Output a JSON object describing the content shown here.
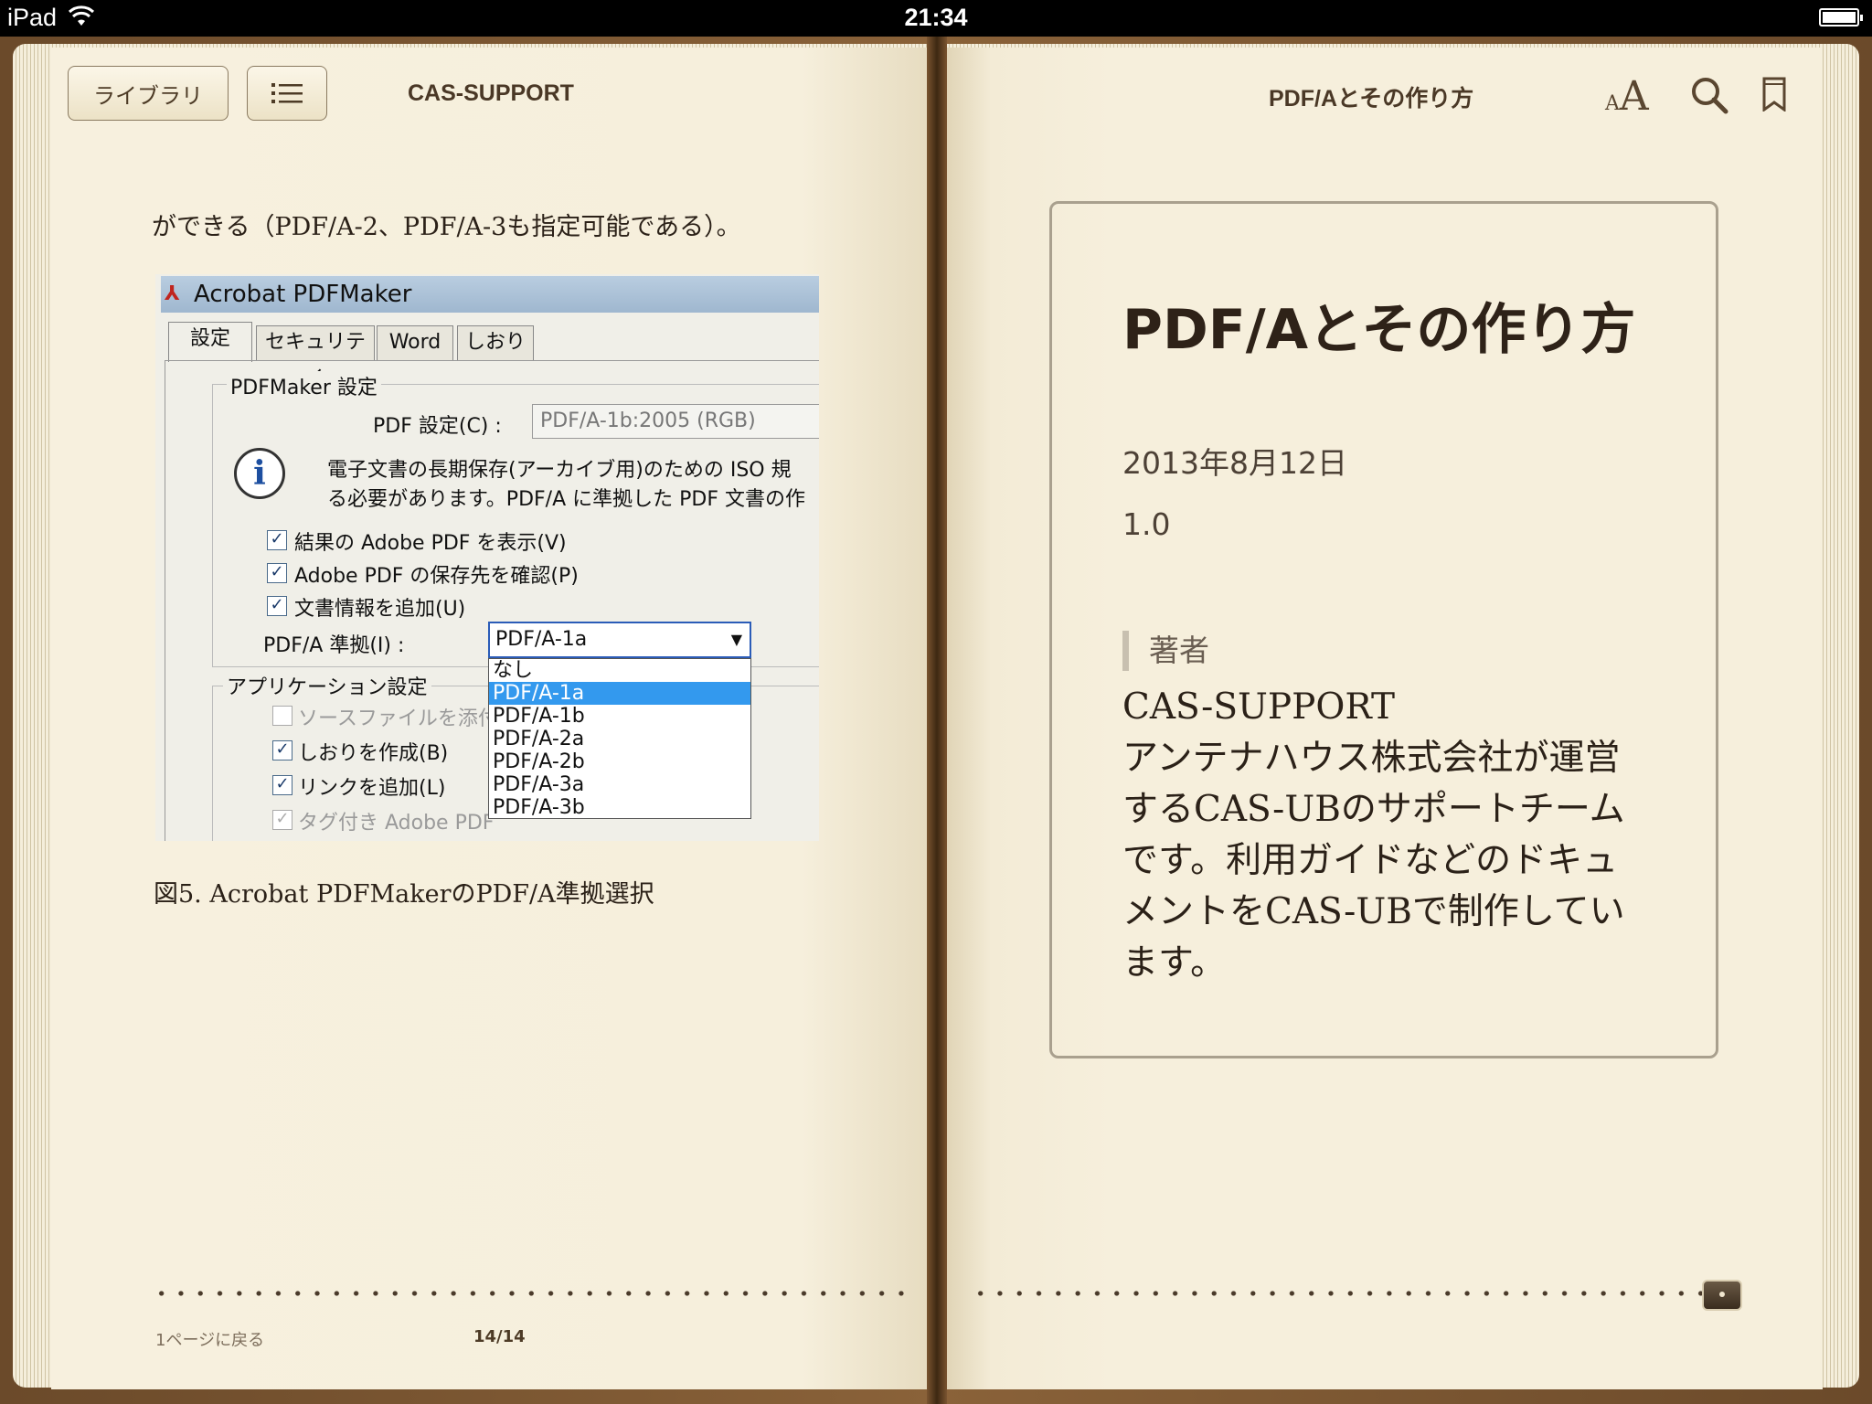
{
  "status_bar": {
    "device": "iPad",
    "time": "21:34"
  },
  "toolbar": {
    "library_label": "ライブラリ",
    "left_title": "CAS-SUPPORT",
    "right_title": "PDF/Aとその作り方",
    "font_icon_label": "AA"
  },
  "left_page": {
    "intro_text": "ができる（PDF/A-2、PDF/A-3も指定可能である）。",
    "figure": {
      "window_title": "Acrobat PDFMaker",
      "tabs": [
        "設定",
        "セキュリティ",
        "Word",
        "しおり"
      ],
      "group_pdfmaker": "PDFMaker 設定",
      "pdf_setting_label": "PDF 設定(C) :",
      "pdf_setting_value": "PDF/A-1b:2005 (RGB)",
      "info_line1": "電子文書の長期保存(アーカイブ用)のための ISO 規",
      "info_line2": "る必要があります。PDF/A に準拠した PDF 文書の作",
      "check1": "結果の Adobe PDF を表示(V)",
      "check2": "Adobe PDF の保存先を確認(P)",
      "check3": "文書情報を追加(U)",
      "pdfa_label": "PDF/A 準拠(I) :",
      "pdfa_selected": "PDF/A-1a",
      "options": [
        "なし",
        "PDF/A-1a",
        "PDF/A-1b",
        "PDF/A-2a",
        "PDF/A-2b",
        "PDF/A-3a",
        "PDF/A-3b"
      ],
      "group_app": "アプリケーション設定",
      "app_check1": "ソースファイルを添付(",
      "app_check2": "しおりを作成(B)",
      "app_check3": "リンクを追加(L)",
      "app_check4": "タグ付き Adobe PDF"
    },
    "caption": "図5. Acrobat PDFMakerのPDF/A準拠選択",
    "back_link": "1ページに戻る",
    "page_number": "14/14"
  },
  "right_page": {
    "book_title": "PDF/Aとその作り方",
    "date": "2013年8月12日",
    "version": "1.0",
    "author_heading": "著者",
    "author_name": "CAS-SUPPORT",
    "author_desc": "アンテナハウス株式会社が運営するCAS-UBのサポートチームです。利用ガイドなどのドキュメントをCAS-UBで制作しています。"
  }
}
